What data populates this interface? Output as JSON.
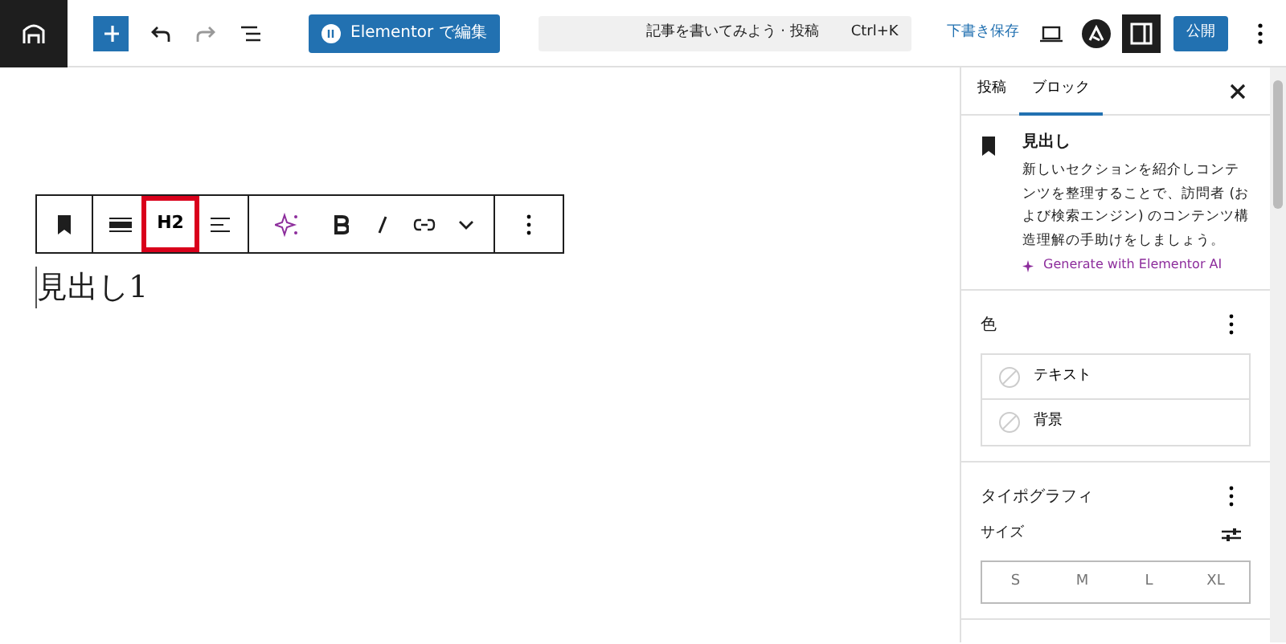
{
  "topbar": {
    "elementor_button": "Elementor で編集",
    "command": {
      "title": "記事を書いてみよう · 投稿",
      "shortcut": "Ctrl+K"
    },
    "save_draft": "下書き保存",
    "publish": "公開",
    "settings_on": true
  },
  "editor": {
    "heading": "見出し1",
    "toolbar": {
      "heading_level": "H2",
      "highlighted": true
    }
  },
  "sidebar": {
    "tabs": [
      {
        "label": "投稿",
        "selected": false
      },
      {
        "label": "ブロック",
        "selected": true
      }
    ],
    "block": {
      "name": "見出し",
      "description": "新しいセクションを紹介しコンテンツを整理することで、訪問者 (および検索エンジン) のコンテンツ構造理解の手助けをしましょう。",
      "ai_link": "Generate with Elementor AI"
    },
    "color": {
      "title": "色",
      "items": [
        {
          "label": "テキスト"
        },
        {
          "label": "背景"
        }
      ]
    },
    "typography": {
      "title": "タイポグラフィ",
      "size_label": "サイズ",
      "sizes": [
        {
          "label": "S",
          "selected": false
        },
        {
          "label": "M",
          "selected": false
        },
        {
          "label": "L",
          "selected": false
        },
        {
          "label": "XL",
          "selected": false
        }
      ]
    }
  }
}
